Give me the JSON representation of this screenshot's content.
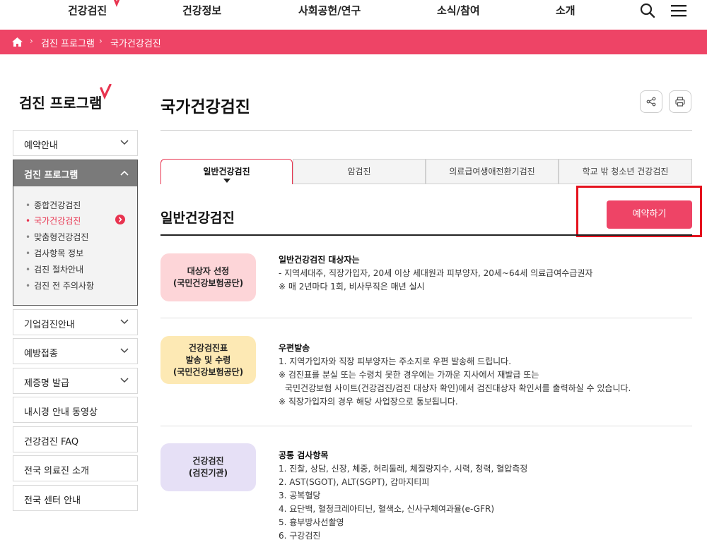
{
  "nav": {
    "items": [
      "건강검진",
      "건강정보",
      "사회공헌/연구",
      "소식/참여",
      "소개"
    ]
  },
  "breadcrumb": {
    "items": [
      "검진 프로그램",
      "국가건강검진"
    ]
  },
  "sidebar": {
    "title": "검진 프로그램",
    "top_menu": "예약안내",
    "open_menu": "검진 프로그램",
    "sub_items": [
      "종합건강검진",
      "국가건강검진",
      "맞춤형건강검진",
      "검사항목 정보",
      "검진 절차안내",
      "검진 전 주의사항"
    ],
    "bottom_menus": [
      "기업검진안내",
      "예방접종",
      "제증명 발급",
      "내시경 안내 동영상",
      "건강검진 FAQ",
      "전국 의료진 소개",
      "전국 센터 안내"
    ]
  },
  "main": {
    "page_title": "국가건강검진",
    "tabs": [
      "일반건강검진",
      "암검진",
      "의료급여생애전환기검진",
      "학교 밖 청소년 건강검진"
    ],
    "section_title": "일반건강검진",
    "reserve_button": "예약하기",
    "blocks": [
      {
        "pill": [
          "대상자 선정",
          "(국민건강보험공단)"
        ],
        "heading": "일반건강검진 대상자는",
        "lines": [
          "- 지역세대주, 직장가입자, 20세 이상 세대원과 피부양자, 20세~64세 의료급여수급권자",
          "※ 매 2년마다 1회, 비사무직은 매년 실시"
        ]
      },
      {
        "pill": [
          "건강검진표",
          "발송 및 수령",
          "(국민건강보험공단)"
        ],
        "heading": "우편발송",
        "lines": [
          "1. 지역가입자와 직장 피부양자는 주소지로 우편 발송해 드립니다.",
          "※ 검진표를 분실 또는 수령치 못한 경우에는 가까운 지사에서 재발급 또는",
          "국민건강보험 사이트(건강검진/검진 대상자 확인)에서 검진대상자 확인서를 출력하실 수 있습니다.",
          "※ 직장가입자의 경우 해당 사업장으로 통보됩니다."
        ]
      },
      {
        "pill": [
          "건강검진",
          "(검진기관)"
        ],
        "heading": "공통 검사항목",
        "lines": [
          "1. 진찰, 상담, 신장, 체중, 허리둘레, 체질량지수, 시력, 청력, 혈압측정",
          "2. AST(SGOT), ALT(SGPT), 감마지티피",
          "3. 공복혈당",
          "4. 요단백, 혈청크레아티닌, 혈색소, 신사구체여과율(e-GFR)",
          "5. 흉부방사선촬영",
          "6. 구강검진"
        ]
      }
    ]
  },
  "colors": {
    "accent": "#ee4466",
    "highlight_border": "#e5121e"
  }
}
